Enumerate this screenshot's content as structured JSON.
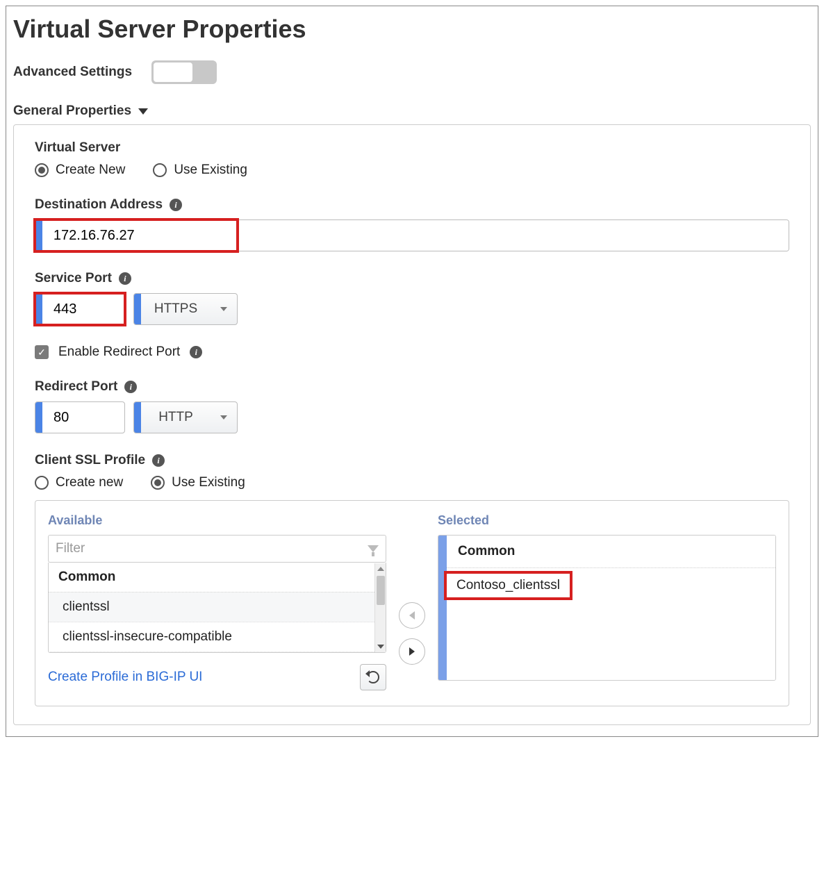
{
  "page_title": "Virtual Server Properties",
  "advanced_settings": {
    "label": "Advanced Settings",
    "enabled": false
  },
  "section_general": {
    "title": "General Properties"
  },
  "virtual_server": {
    "label": "Virtual Server",
    "options": {
      "create_new": "Create New",
      "use_existing": "Use Existing"
    },
    "selected": "create_new"
  },
  "destination_address": {
    "label": "Destination Address",
    "value": "172.16.76.27"
  },
  "service_port": {
    "label": "Service Port",
    "value": "443",
    "protocol": "HTTPS"
  },
  "enable_redirect_port": {
    "label": "Enable Redirect Port",
    "checked": true
  },
  "redirect_port": {
    "label": "Redirect Port",
    "value": "80",
    "protocol": "HTTP"
  },
  "client_ssl_profile": {
    "label": "Client SSL Profile",
    "options": {
      "create_new": "Create new",
      "use_existing": "Use Existing"
    },
    "selected": "use_existing"
  },
  "dual_list": {
    "available_title": "Available",
    "selected_title": "Selected",
    "filter_placeholder": "Filter",
    "group_label": "Common",
    "available_items": [
      "clientssl",
      "clientssl-insecure-compatible"
    ],
    "selected_items": [
      "Contoso_clientssl"
    ],
    "create_link": "Create Profile in BIG-IP UI"
  }
}
